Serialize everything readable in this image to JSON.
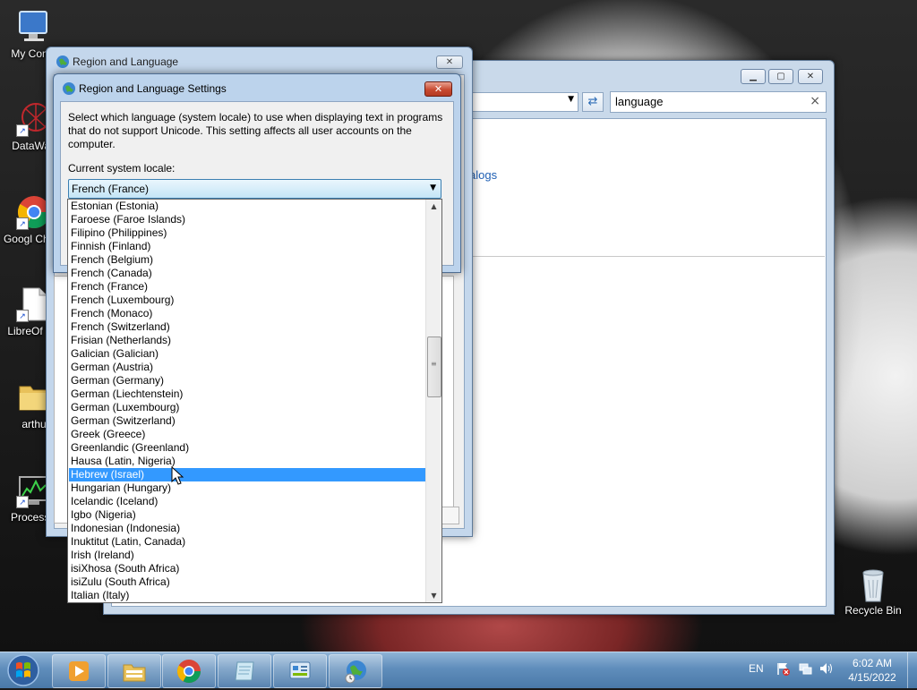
{
  "desktop": {
    "icons": [
      {
        "label": "My Comp",
        "icon": "computer-icon"
      },
      {
        "label": "DataWag",
        "icon": "datawag-icon"
      },
      {
        "label": "Googl Chron",
        "icon": "chrome-icon"
      },
      {
        "label": "LibreOf 7.3",
        "icon": "libreoffice-icon"
      },
      {
        "label": "arthu",
        "icon": "folder-icon"
      },
      {
        "label": "ProcessH",
        "icon": "processhacker-icon"
      },
      {
        "label": "Recycle Bin",
        "icon": "recycle-bin-icon"
      }
    ]
  },
  "background_window": {
    "search_value": "language",
    "link_text": "alogs"
  },
  "region_language_window": {
    "title": "Region and Language"
  },
  "settings_dialog": {
    "title": "Region and Language Settings",
    "description": "Select which language (system locale) to use when displaying text in programs that do not support Unicode. This setting affects all user accounts on the computer.",
    "locale_label": "Current system locale:",
    "selected_locale": "French (France)"
  },
  "locale_list": {
    "items": [
      "Estonian (Estonia)",
      "Faroese (Faroe Islands)",
      "Filipino (Philippines)",
      "Finnish (Finland)",
      "French (Belgium)",
      "French (Canada)",
      "French (France)",
      "French (Luxembourg)",
      "French (Monaco)",
      "French (Switzerland)",
      "Frisian (Netherlands)",
      "Galician (Galician)",
      "German (Austria)",
      "German (Germany)",
      "German (Liechtenstein)",
      "German (Luxembourg)",
      "German (Switzerland)",
      "Greek (Greece)",
      "Greenlandic (Greenland)",
      "Hausa (Latin, Nigeria)",
      "Hebrew (Israel)",
      "Hungarian (Hungary)",
      "Icelandic (Iceland)",
      "Igbo (Nigeria)",
      "Indonesian (Indonesia)",
      "Inuktitut (Latin, Canada)",
      "Irish (Ireland)",
      "isiXhosa (South Africa)",
      "isiZulu (South Africa)",
      "Italian (Italy)"
    ],
    "highlighted_item": "Hebrew (Israel)"
  },
  "taskbar": {
    "apps": [
      "media-player-icon",
      "file-explorer-icon",
      "chrome-icon",
      "notepad-icon",
      "control-panel-icon",
      "region-language-icon"
    ],
    "language": "EN",
    "time": "6:02 AM",
    "date": "4/15/2022"
  },
  "colors": {
    "selection": "#3399ff",
    "taskbar": "#5f8dbb",
    "close_red": "#c84a31"
  }
}
